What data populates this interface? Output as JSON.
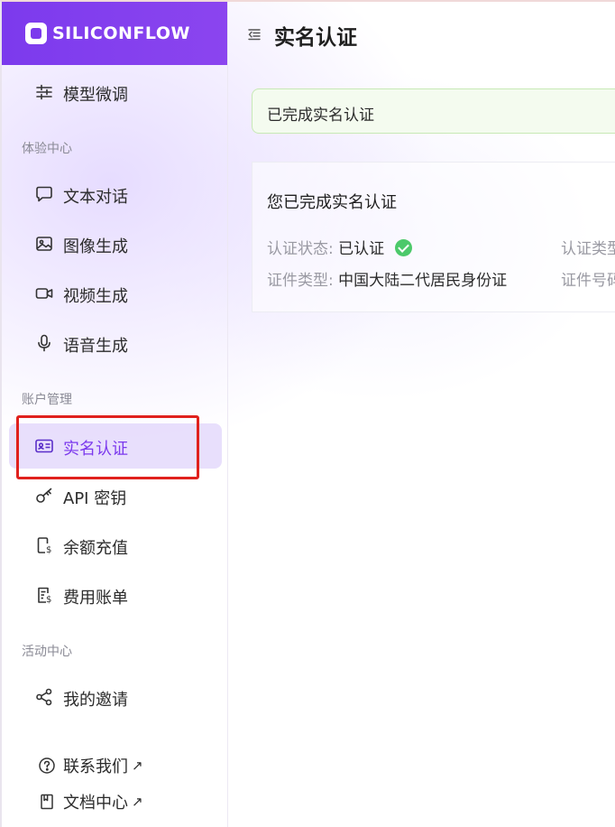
{
  "brand": {
    "name": "SILICONFLOW"
  },
  "header": {
    "title": "实名认证"
  },
  "sidebar": {
    "top_item": {
      "label": "模型微调",
      "icon": "sliders-icon"
    },
    "sections": [
      {
        "title": "体验中心",
        "items": [
          {
            "label": "文本对话",
            "icon": "chat-bubble-icon"
          },
          {
            "label": "图像生成",
            "icon": "image-icon"
          },
          {
            "label": "视频生成",
            "icon": "video-camera-icon"
          },
          {
            "label": "语音生成",
            "icon": "microphone-icon"
          }
        ]
      },
      {
        "title": "账户管理",
        "items": [
          {
            "label": "实名认证",
            "icon": "id-card-icon",
            "active": true
          },
          {
            "label": "API 密钥",
            "icon": "key-icon"
          },
          {
            "label": "余额充值",
            "icon": "wallet-icon"
          },
          {
            "label": "费用账单",
            "icon": "bill-icon"
          }
        ]
      },
      {
        "title": "活动中心",
        "items": [
          {
            "label": "我的邀请",
            "icon": "share-icon"
          }
        ]
      }
    ],
    "footer": [
      {
        "label": "联系我们",
        "icon": "question-circle-icon",
        "arrow": "↗"
      },
      {
        "label": "文档中心",
        "icon": "book-icon",
        "arrow": "↗"
      }
    ]
  },
  "alert": {
    "text": "已完成实名认证"
  },
  "card": {
    "title": "您已完成实名认证",
    "status_label": "认证状态:",
    "status_value": "已认证",
    "id_type_label": "证件类型:",
    "id_type_value": "中国大陆二代居民身份证",
    "auth_type_label": "认证类型",
    "id_number_label": "证件号码"
  },
  "colors": {
    "accent": "#7c3aed",
    "highlight": "#e0211d",
    "success": "#4cc96a",
    "alert_bg": "#f4fbef",
    "alert_border": "#c7e9b5"
  }
}
